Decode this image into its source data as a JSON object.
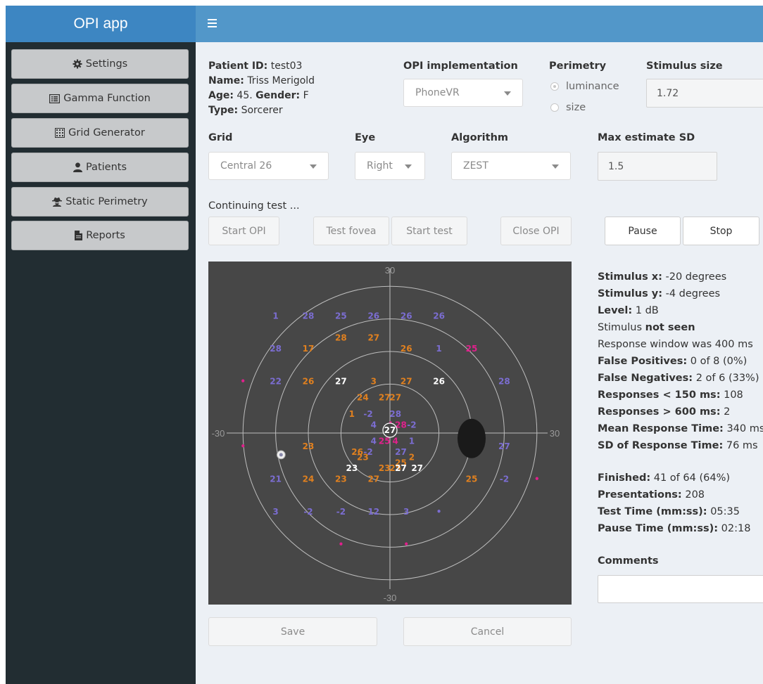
{
  "app": {
    "title": "OPI app"
  },
  "sidebar": {
    "items": [
      {
        "label": "Settings",
        "icon": "cog-icon"
      },
      {
        "label": "Gamma Function",
        "icon": "list-alt-icon"
      },
      {
        "label": "Grid Generator",
        "icon": "grid-icon"
      },
      {
        "label": "Patients",
        "icon": "user-icon"
      },
      {
        "label": "Static Perimetry",
        "icon": "user-secret-icon"
      },
      {
        "label": "Reports",
        "icon": "file-icon"
      }
    ]
  },
  "patient": {
    "id_label": "Patient ID:",
    "id": "test03",
    "name_label": "Name:",
    "name": "Triss Merigold",
    "age_label": "Age:",
    "age": "45.",
    "gender_label": "Gender:",
    "gender": "F",
    "type_label": "Type:",
    "type": "Sorcerer"
  },
  "form": {
    "opi_label": "OPI implementation",
    "opi_value": "PhoneVR",
    "perimetry_label": "Perimetry",
    "perimetry_options": [
      "luminance",
      "size"
    ],
    "perimetry_selected": "luminance",
    "stimulus_size_label": "Stimulus size",
    "stimulus_size_value": "1.72",
    "grid_label": "Grid",
    "grid_value": "Central 26",
    "eye_label": "Eye",
    "eye_value": "Right",
    "algorithm_label": "Algorithm",
    "algorithm_value": "ZEST",
    "max_sd_label": "Max estimate SD",
    "max_sd_value": "1.5"
  },
  "status_text": "Continuing test ...",
  "buttons": {
    "start_opi": "Start OPI",
    "test_fovea": "Test fovea",
    "start_test": "Start test",
    "close_opi": "Close OPI",
    "pause": "Pause",
    "stop": "Stop",
    "save": "Save",
    "cancel": "Cancel"
  },
  "chart_data": {
    "type": "scatter",
    "axis_labels": {
      "top": "30",
      "bottom": "-30",
      "left": "-30",
      "right": "30"
    },
    "xlim": [
      -30,
      30
    ],
    "ylim": [
      -30,
      30
    ],
    "rings_deg": [
      9,
      15,
      21,
      27
    ],
    "colors": {
      "background": "#474747",
      "grid": "#bdbdbd",
      "purple": "#7b6dd1",
      "orange": "#e0801f",
      "white": "#ffffff",
      "magenta": "#e0208c"
    },
    "current_stimulus": {
      "x": -20,
      "y": -4
    },
    "blind_spot": {
      "x": 15,
      "y": -1
    },
    "points": [
      {
        "x": -21,
        "y": 21,
        "label": "1",
        "color": "purple"
      },
      {
        "x": -15,
        "y": 21,
        "label": "28",
        "color": "purple"
      },
      {
        "x": -9,
        "y": 21,
        "label": "25",
        "color": "purple"
      },
      {
        "x": -3,
        "y": 21,
        "label": "26",
        "color": "purple"
      },
      {
        "x": 3,
        "y": 21,
        "label": "26",
        "color": "purple"
      },
      {
        "x": 9,
        "y": 21,
        "label": "26",
        "color": "purple"
      },
      {
        "x": -21,
        "y": 15,
        "label": "28",
        "color": "purple"
      },
      {
        "x": -15,
        "y": 15,
        "label": "17",
        "color": "orange"
      },
      {
        "x": -9,
        "y": 17,
        "label": "28",
        "color": "orange"
      },
      {
        "x": -3,
        "y": 17,
        "label": "27",
        "color": "orange"
      },
      {
        "x": 3,
        "y": 15,
        "label": "26",
        "color": "orange"
      },
      {
        "x": 9,
        "y": 15,
        "label": "1",
        "color": "purple"
      },
      {
        "x": -27,
        "y": 9,
        "label": "•",
        "color": "magenta"
      },
      {
        "x": -21,
        "y": 9,
        "label": "22",
        "color": "purple"
      },
      {
        "x": -15,
        "y": 9,
        "label": "26",
        "color": "orange"
      },
      {
        "x": 21,
        "y": 9,
        "label": "28",
        "color": "purple"
      },
      {
        "x": 15,
        "y": 15,
        "label": "25",
        "color": "magenta"
      },
      {
        "x": -9,
        "y": 9,
        "label": "27",
        "color": "white"
      },
      {
        "x": -3,
        "y": 9,
        "label": "3",
        "color": "orange"
      },
      {
        "x": 3,
        "y": 9,
        "label": "27",
        "color": "orange"
      },
      {
        "x": 9,
        "y": 9,
        "label": "26",
        "color": "white"
      },
      {
        "x": -27,
        "y": -3,
        "label": "•",
        "color": "magenta"
      },
      {
        "x": -15,
        "y": -3,
        "label": "23",
        "color": "orange"
      },
      {
        "x": 21,
        "y": -3,
        "label": "27",
        "color": "purple"
      },
      {
        "x": -15,
        "y": -9,
        "label": "24",
        "color": "orange"
      },
      {
        "x": 15,
        "y": -9,
        "label": "25",
        "color": "orange"
      },
      {
        "x": 21,
        "y": -9,
        "label": "-2",
        "color": "purple"
      },
      {
        "x": -21,
        "y": -9,
        "label": "21",
        "color": "purple"
      },
      {
        "x": -9,
        "y": -9,
        "label": "23",
        "color": "orange"
      },
      {
        "x": -3,
        "y": -9,
        "label": "27",
        "color": "orange"
      },
      {
        "x": -21,
        "y": -15,
        "label": "3",
        "color": "purple"
      },
      {
        "x": -15,
        "y": -15,
        "label": "-2",
        "color": "purple"
      },
      {
        "x": -9,
        "y": -15,
        "label": "-2",
        "color": "purple"
      },
      {
        "x": -3,
        "y": -15,
        "label": "12",
        "color": "purple"
      },
      {
        "x": 3,
        "y": -15,
        "label": "3",
        "color": "purple"
      },
      {
        "x": 9,
        "y": -15,
        "label": "•",
        "color": "purple"
      },
      {
        "x": 27,
        "y": -9,
        "label": "•",
        "color": "magenta"
      },
      {
        "x": -9,
        "y": -21,
        "label": "•",
        "color": "magenta"
      },
      {
        "x": 3,
        "y": -21,
        "label": "•",
        "color": "magenta"
      },
      {
        "x": -5,
        "y": 6,
        "label": "24",
        "color": "orange"
      },
      {
        "x": -1,
        "y": 6,
        "label": "27",
        "color": "orange"
      },
      {
        "x": 1,
        "y": 6,
        "label": "27",
        "color": "orange"
      },
      {
        "x": -7,
        "y": 3,
        "label": "1",
        "color": "orange"
      },
      {
        "x": -4,
        "y": 3,
        "label": "-2",
        "color": "purple"
      },
      {
        "x": 1,
        "y": 3,
        "label": "28",
        "color": "purple"
      },
      {
        "x": -3,
        "y": 1,
        "label": "4",
        "color": "purple"
      },
      {
        "x": 0,
        "y": 1,
        "label": "4",
        "color": "magenta"
      },
      {
        "x": 2,
        "y": 1,
        "label": "28",
        "color": "magenta"
      },
      {
        "x": 4,
        "y": 1,
        "label": "-2",
        "color": "purple"
      },
      {
        "x": -3,
        "y": -2,
        "label": "4",
        "color": "purple"
      },
      {
        "x": -1,
        "y": -2,
        "label": "25",
        "color": "magenta"
      },
      {
        "x": 1,
        "y": -2,
        "label": "4",
        "color": "magenta"
      },
      {
        "x": 4,
        "y": -2,
        "label": "1",
        "color": "purple"
      },
      {
        "x": -4,
        "y": -4,
        "label": "-2",
        "color": "purple"
      },
      {
        "x": 2,
        "y": -4,
        "label": "27",
        "color": "purple"
      },
      {
        "x": -6,
        "y": -4,
        "label": "26",
        "color": "orange"
      },
      {
        "x": -5,
        "y": -5,
        "label": "23",
        "color": "orange"
      },
      {
        "x": 2,
        "y": -6,
        "label": "25",
        "color": "orange"
      },
      {
        "x": 4,
        "y": -5,
        "label": "2",
        "color": "orange"
      },
      {
        "x": -7,
        "y": -7,
        "label": "23",
        "color": "white"
      },
      {
        "x": -1,
        "y": -7,
        "label": "23",
        "color": "orange"
      },
      {
        "x": 1,
        "y": -7,
        "label": "25",
        "color": "orange"
      },
      {
        "x": 5,
        "y": -7,
        "label": "27",
        "color": "white"
      },
      {
        "x": 2,
        "y": -7,
        "label": "27",
        "color": "white"
      },
      {
        "x": 0,
        "y": 0,
        "label": "27",
        "color": "white",
        "circled": true
      }
    ]
  },
  "stats": {
    "stim_x_label": "Stimulus x:",
    "stim_x": "-20 degrees",
    "stim_y_label": "Stimulus y:",
    "stim_y": "-4 degrees",
    "level_label": "Level:",
    "level": "1 dB",
    "stimulus_prefix": "Stimulus",
    "stimulus_status": "not seen",
    "response_window": "Response window was 400 ms",
    "fp_label": "False Positives:",
    "fp": "0 of 8 (0%)",
    "fn_label": "False Negatives:",
    "fn": "2 of 6 (33%)",
    "fast_label": "Responses < 150 ms:",
    "fast": "108",
    "slow_label": "Responses > 600 ms:",
    "slow": "2",
    "mean_rt_label": "Mean Response Time:",
    "mean_rt": "340 ms",
    "sd_rt_label": "SD of Response Time:",
    "sd_rt": "76 ms",
    "finished_label": "Finished:",
    "finished": "41 of 64 (64%)",
    "presentations_label": "Presentations:",
    "presentations": "208",
    "test_time_label": "Test Time (mm:ss):",
    "test_time": "05:35",
    "pause_time_label": "Pause Time (mm:ss):",
    "pause_time": "02:18"
  },
  "comments": {
    "label": "Comments",
    "value": ""
  }
}
